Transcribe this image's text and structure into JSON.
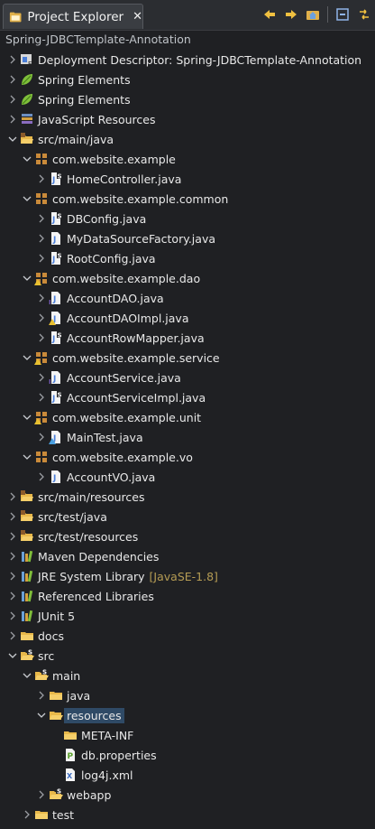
{
  "view": {
    "tab_title": "Project Explorer",
    "close_glyph": "✕",
    "path": "Spring-JDBCTemplate-Annotation",
    "toolbar": [
      "back-icon",
      "forward-icon",
      "home-icon",
      "collapse-all-icon",
      "link-editor-icon"
    ]
  },
  "tree": [
    {
      "label": "Deployment Descriptor: Spring-JDBCTemplate-Annotation",
      "level": 1,
      "state": "collapsed",
      "icon": "deployment-descriptor-icon"
    },
    {
      "label": "Spring Elements",
      "level": 1,
      "state": "collapsed",
      "icon": "spring-leaf-icon"
    },
    {
      "label": "Spring Elements",
      "level": 1,
      "state": "collapsed",
      "icon": "spring-leaf-icon"
    },
    {
      "label": "JavaScript Resources",
      "level": 1,
      "state": "collapsed",
      "icon": "javascript-resources-icon"
    },
    {
      "label": "src/main/java",
      "level": 1,
      "state": "expanded",
      "icon": "source-folder-icon"
    },
    {
      "label": "com.website.example",
      "level": 2,
      "state": "expanded",
      "icon": "package-icon"
    },
    {
      "label": "HomeController.java",
      "level": 3,
      "state": "collapsed",
      "icon": "java-file-spring-icon"
    },
    {
      "label": "com.website.example.common",
      "level": 2,
      "state": "expanded",
      "icon": "package-icon"
    },
    {
      "label": "DBConfig.java",
      "level": 3,
      "state": "collapsed",
      "icon": "java-file-spring-icon"
    },
    {
      "label": "MyDataSourceFactory.java",
      "level": 3,
      "state": "collapsed",
      "icon": "java-file-icon"
    },
    {
      "label": "RootConfig.java",
      "level": 3,
      "state": "collapsed",
      "icon": "java-file-spring-icon"
    },
    {
      "label": "com.website.example.dao",
      "level": 2,
      "state": "expanded",
      "icon": "package-warn-icon"
    },
    {
      "label": "AccountDAO.java",
      "level": 3,
      "state": "collapsed",
      "icon": "java-interface-icon"
    },
    {
      "label": "AccountDAOImpl.java",
      "level": 3,
      "state": "collapsed",
      "icon": "java-file-warn-icon"
    },
    {
      "label": "AccountRowMapper.java",
      "level": 3,
      "state": "collapsed",
      "icon": "java-file-spring-icon"
    },
    {
      "label": "com.website.example.service",
      "level": 2,
      "state": "expanded",
      "icon": "package-warn-icon"
    },
    {
      "label": "AccountService.java",
      "level": 3,
      "state": "collapsed",
      "icon": "java-interface-icon"
    },
    {
      "label": "AccountServiceImpl.java",
      "level": 3,
      "state": "collapsed",
      "icon": "java-file-spring-icon"
    },
    {
      "label": "com.website.example.unit",
      "level": 2,
      "state": "expanded",
      "icon": "package-warn-icon"
    },
    {
      "label": "MainTest.java",
      "level": 3,
      "state": "collapsed",
      "icon": "java-test-icon"
    },
    {
      "label": "com.website.example.vo",
      "level": 2,
      "state": "expanded",
      "icon": "package-icon"
    },
    {
      "label": "AccountVO.java",
      "level": 3,
      "state": "collapsed",
      "icon": "java-file-icon"
    },
    {
      "label": "src/main/resources",
      "level": 1,
      "state": "collapsed",
      "icon": "source-folder-icon"
    },
    {
      "label": "src/test/java",
      "level": 1,
      "state": "collapsed",
      "icon": "source-folder-icon"
    },
    {
      "label": "src/test/resources",
      "level": 1,
      "state": "collapsed",
      "icon": "source-folder-icon"
    },
    {
      "label": "Maven Dependencies",
      "level": 1,
      "state": "collapsed",
      "icon": "library-icon"
    },
    {
      "label": "JRE System Library",
      "decoration": "[JavaSE-1.8]",
      "level": 1,
      "state": "collapsed",
      "icon": "library-icon"
    },
    {
      "label": "Referenced Libraries",
      "level": 1,
      "state": "collapsed",
      "icon": "library-icon"
    },
    {
      "label": "JUnit 5",
      "level": 1,
      "state": "collapsed",
      "icon": "library-icon"
    },
    {
      "label": "docs",
      "level": 1,
      "state": "collapsed",
      "icon": "folder-icon"
    },
    {
      "label": "src",
      "level": 1,
      "state": "expanded",
      "icon": "folder-spring-icon"
    },
    {
      "label": "main",
      "level": 2,
      "state": "expanded",
      "icon": "folder-spring-icon"
    },
    {
      "label": "java",
      "level": 3,
      "state": "collapsed",
      "icon": "folder-icon"
    },
    {
      "label": "resources",
      "level": 3,
      "state": "expanded",
      "icon": "folder-open-icon",
      "selected": true
    },
    {
      "label": "META-INF",
      "level": 4,
      "state": "none",
      "icon": "folder-icon"
    },
    {
      "label": "db.properties",
      "level": 4,
      "state": "none",
      "icon": "properties-file-icon"
    },
    {
      "label": "log4j.xml",
      "level": 4,
      "state": "none",
      "icon": "xml-file-icon"
    },
    {
      "label": "webapp",
      "level": 3,
      "state": "collapsed",
      "icon": "folder-spring-icon"
    },
    {
      "label": "test",
      "level": 2,
      "state": "collapsed",
      "icon": "folder-icon"
    }
  ],
  "colors": {
    "background": "#1f2023",
    "selection": "#2f4a66",
    "decoration": "#b59c54",
    "folder": "#e8b84a",
    "package": "#c98a3a",
    "java_file": "#4a7ed8"
  }
}
